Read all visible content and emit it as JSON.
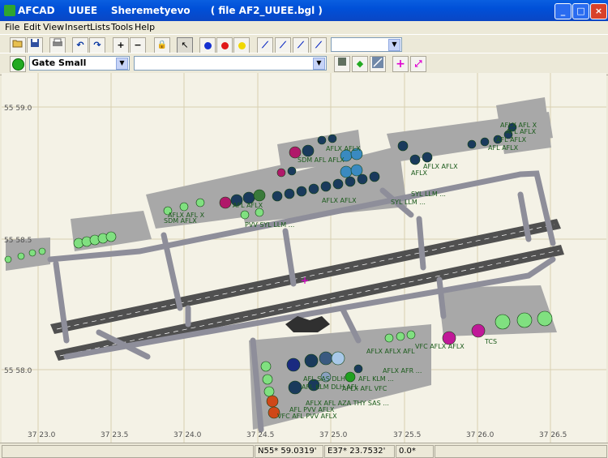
{
  "window": {
    "app_name": "AFCAD",
    "title": "AFCAD    UUEE    Sheremetyevo      ( file AF2_UUEE.bgl )",
    "minimize_glyph": "_",
    "maximize_glyph": "□",
    "close_glyph": "×"
  },
  "menu": {
    "items": [
      "File",
      "Edit",
      "View",
      "Insert",
      "Lists",
      "Tools",
      "Help"
    ]
  },
  "toolbar1": {
    "open_icon": "open-folder-icon",
    "save_icon": "save-disk-icon",
    "print_icon": "printer-icon",
    "undo_glyph": "↶",
    "redo_glyph": "↷",
    "zoom_in_glyph": "+",
    "zoom_out_glyph": "−",
    "lock_glyph": "🔒",
    "pointer_glyph": "↖",
    "node_colors": [
      "#1430d0",
      "#e01818",
      "#f0d800"
    ],
    "path_glyph": "⟋",
    "layer_select_value": ""
  },
  "toolbar2": {
    "parking_type_value": "Gate Small",
    "airline_codes_value": "",
    "colors": {
      "accent_green": "#22aa22",
      "accent_magenta": "#e000d0"
    }
  },
  "map": {
    "lat_labels": [
      "55 59.0",
      "55 58.5",
      "55 58.0"
    ],
    "lon_labels": [
      "37 23.0",
      "37 23.5",
      "37 24.0",
      "37 24.5",
      "37 25.0",
      "37 25.5",
      "37 26.0",
      "37 26.5"
    ],
    "airline_tags": [
      "AFLX AFL X",
      "AFL AFLX",
      "AFL AFLX",
      "AFL AFLX",
      "AFLX AFLX",
      "SDM AFL AFLX",
      "AFLX AFLX",
      "AFLX",
      "SDM AFLX",
      "SYL LLM ...",
      "SYL LLM ...",
      "PVV SYL LLM ...",
      "AFLX AFL X",
      "AFLX AFLX",
      "AFL AFLX",
      "TCS",
      "VFC AFLX AFLX",
      "AFL SAS DLH",
      "AFL KLM DLH AFL",
      "AFLX AFL AZA THY SAS ...",
      "AFL PVV AFLX",
      "VFC AFL PVV AFLX",
      "AFLX AFLX AFL",
      "AFLX AFR ...",
      "AFL KLM ...",
      "AFLX AFL VFC"
    ]
  },
  "status": {
    "empty_left": "",
    "latitude": "N55* 59.0319'",
    "longitude": "E37* 23.7532'",
    "heading": "0.0*",
    "empty_right": ""
  }
}
